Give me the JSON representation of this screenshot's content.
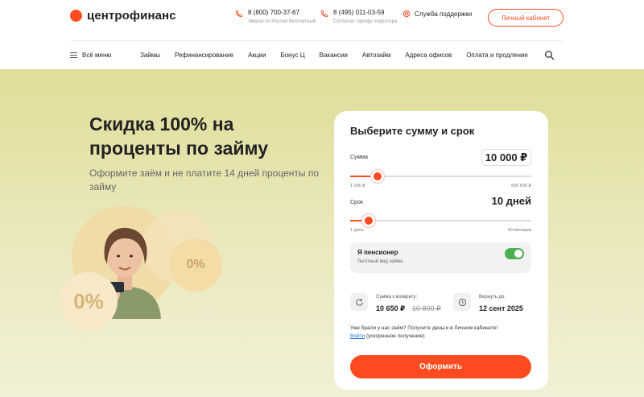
{
  "header": {
    "logo_text": "центрофинанс",
    "phone1": {
      "number": "8 (800) 700-37-67",
      "note": "Звонок по России бесплатный"
    },
    "phone2": {
      "number": "8 (495) 011-03-59",
      "note": "Согласно тарифу оператора"
    },
    "support_label": "Служба поддержки",
    "cabinet_label": "Личный кабинет"
  },
  "nav": {
    "all_menu": "Всё меню",
    "items": [
      "Займы",
      "Рефинансирование",
      "Акции",
      "Бонус Ц",
      "Вакансии",
      "Автозайм",
      "Адреса офисов",
      "Оплата и продление"
    ]
  },
  "hero": {
    "title": "Скидка 100% на проценты по займу",
    "subtitle": "Оформите заём и не платите 14 дней проценты по займу",
    "badge_big": "0%",
    "badge_small": "0%"
  },
  "calculator": {
    "title": "Выберите сумму и срок",
    "amount": {
      "label": "Сумма",
      "value": "10 000 ₽",
      "min": "1 000 ₽",
      "max": "500 000 ₽",
      "fraction": 0.15
    },
    "term": {
      "label": "Срок",
      "value": "10 дней",
      "min": "1 день",
      "max": "60 месяцев",
      "fraction": 0.1
    },
    "pensioner": {
      "title": "Я пенсионер",
      "subtitle": "Льготный вид займа",
      "enabled": true
    },
    "return_label": "Сумма к возврату:",
    "return_value": "10 650 ₽",
    "return_old": "10 800 ₽",
    "due_label": "Вернуть до:",
    "due_value": "12 сент 2025",
    "note_text": "Уже брали у нас займ? Получите деньги в Личном кабинете!",
    "note_link": "Войти",
    "note_after": "(ускоренное получение)",
    "submit_label": "Оформить"
  },
  "colors": {
    "accent": "#ff4b1f",
    "toggle_on": "#4caf50",
    "hero_bg": "#e0dd9a"
  }
}
